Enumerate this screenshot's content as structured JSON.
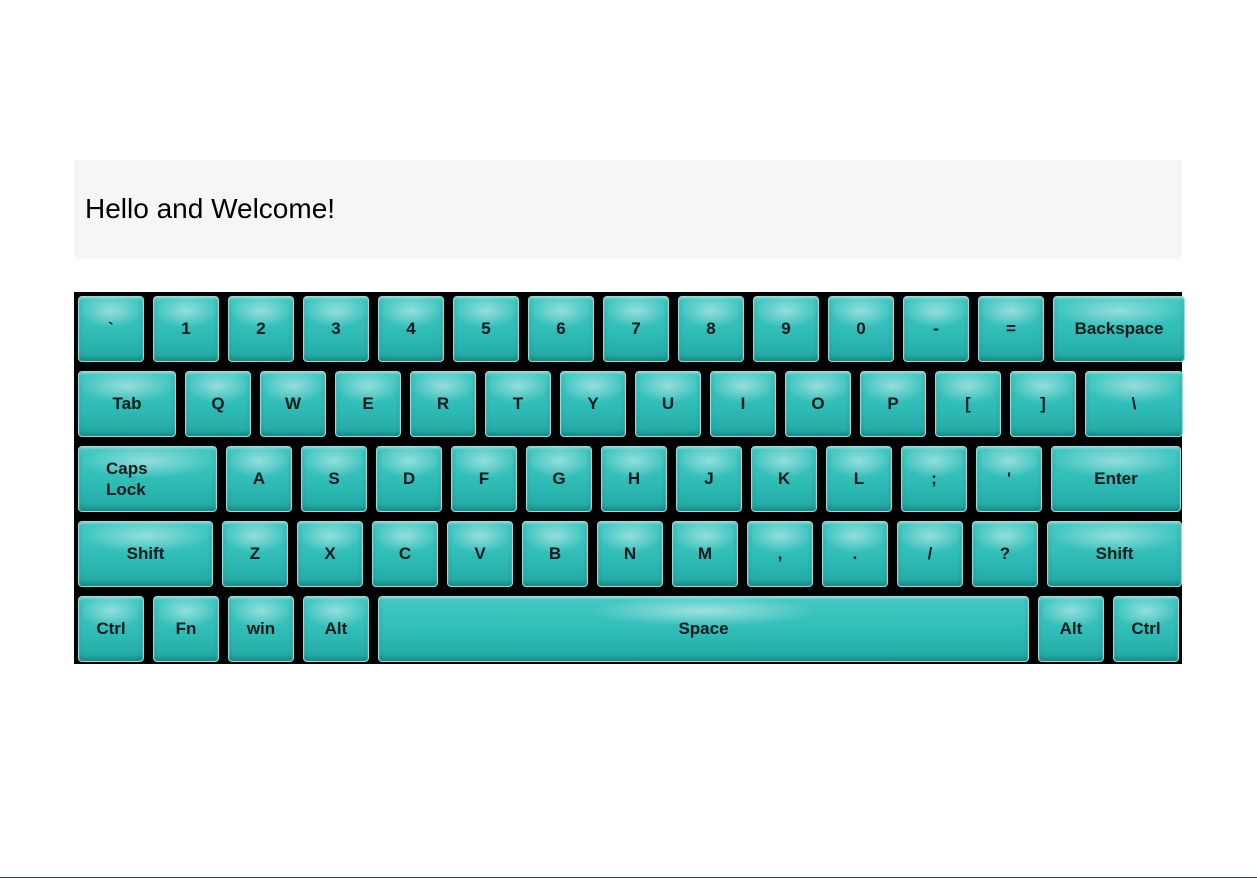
{
  "display": {
    "text": "Hello and Welcome!"
  },
  "keyboard": {
    "key_color": "#35c2bd",
    "rows": [
      [
        "`",
        "1",
        "2",
        "3",
        "4",
        "5",
        "6",
        "7",
        "8",
        "9",
        "0",
        "-",
        "=",
        "Backspace"
      ],
      [
        "Tab",
        "Q",
        "W",
        "E",
        "R",
        "T",
        "Y",
        "U",
        "I",
        "O",
        "P",
        "[",
        "]",
        "\\"
      ],
      [
        "Caps\nLock",
        "A",
        "S",
        "D",
        "F",
        "G",
        "H",
        "J",
        "K",
        "L",
        ";",
        "'",
        "Enter"
      ],
      [
        "Shift",
        "Z",
        "X",
        "C",
        "V",
        "B",
        "N",
        "M",
        ",",
        ".",
        "/",
        "?",
        "Shift"
      ],
      [
        "Ctrl",
        "Fn",
        "win",
        "Alt",
        "Space",
        "Alt",
        "Ctrl"
      ]
    ]
  }
}
